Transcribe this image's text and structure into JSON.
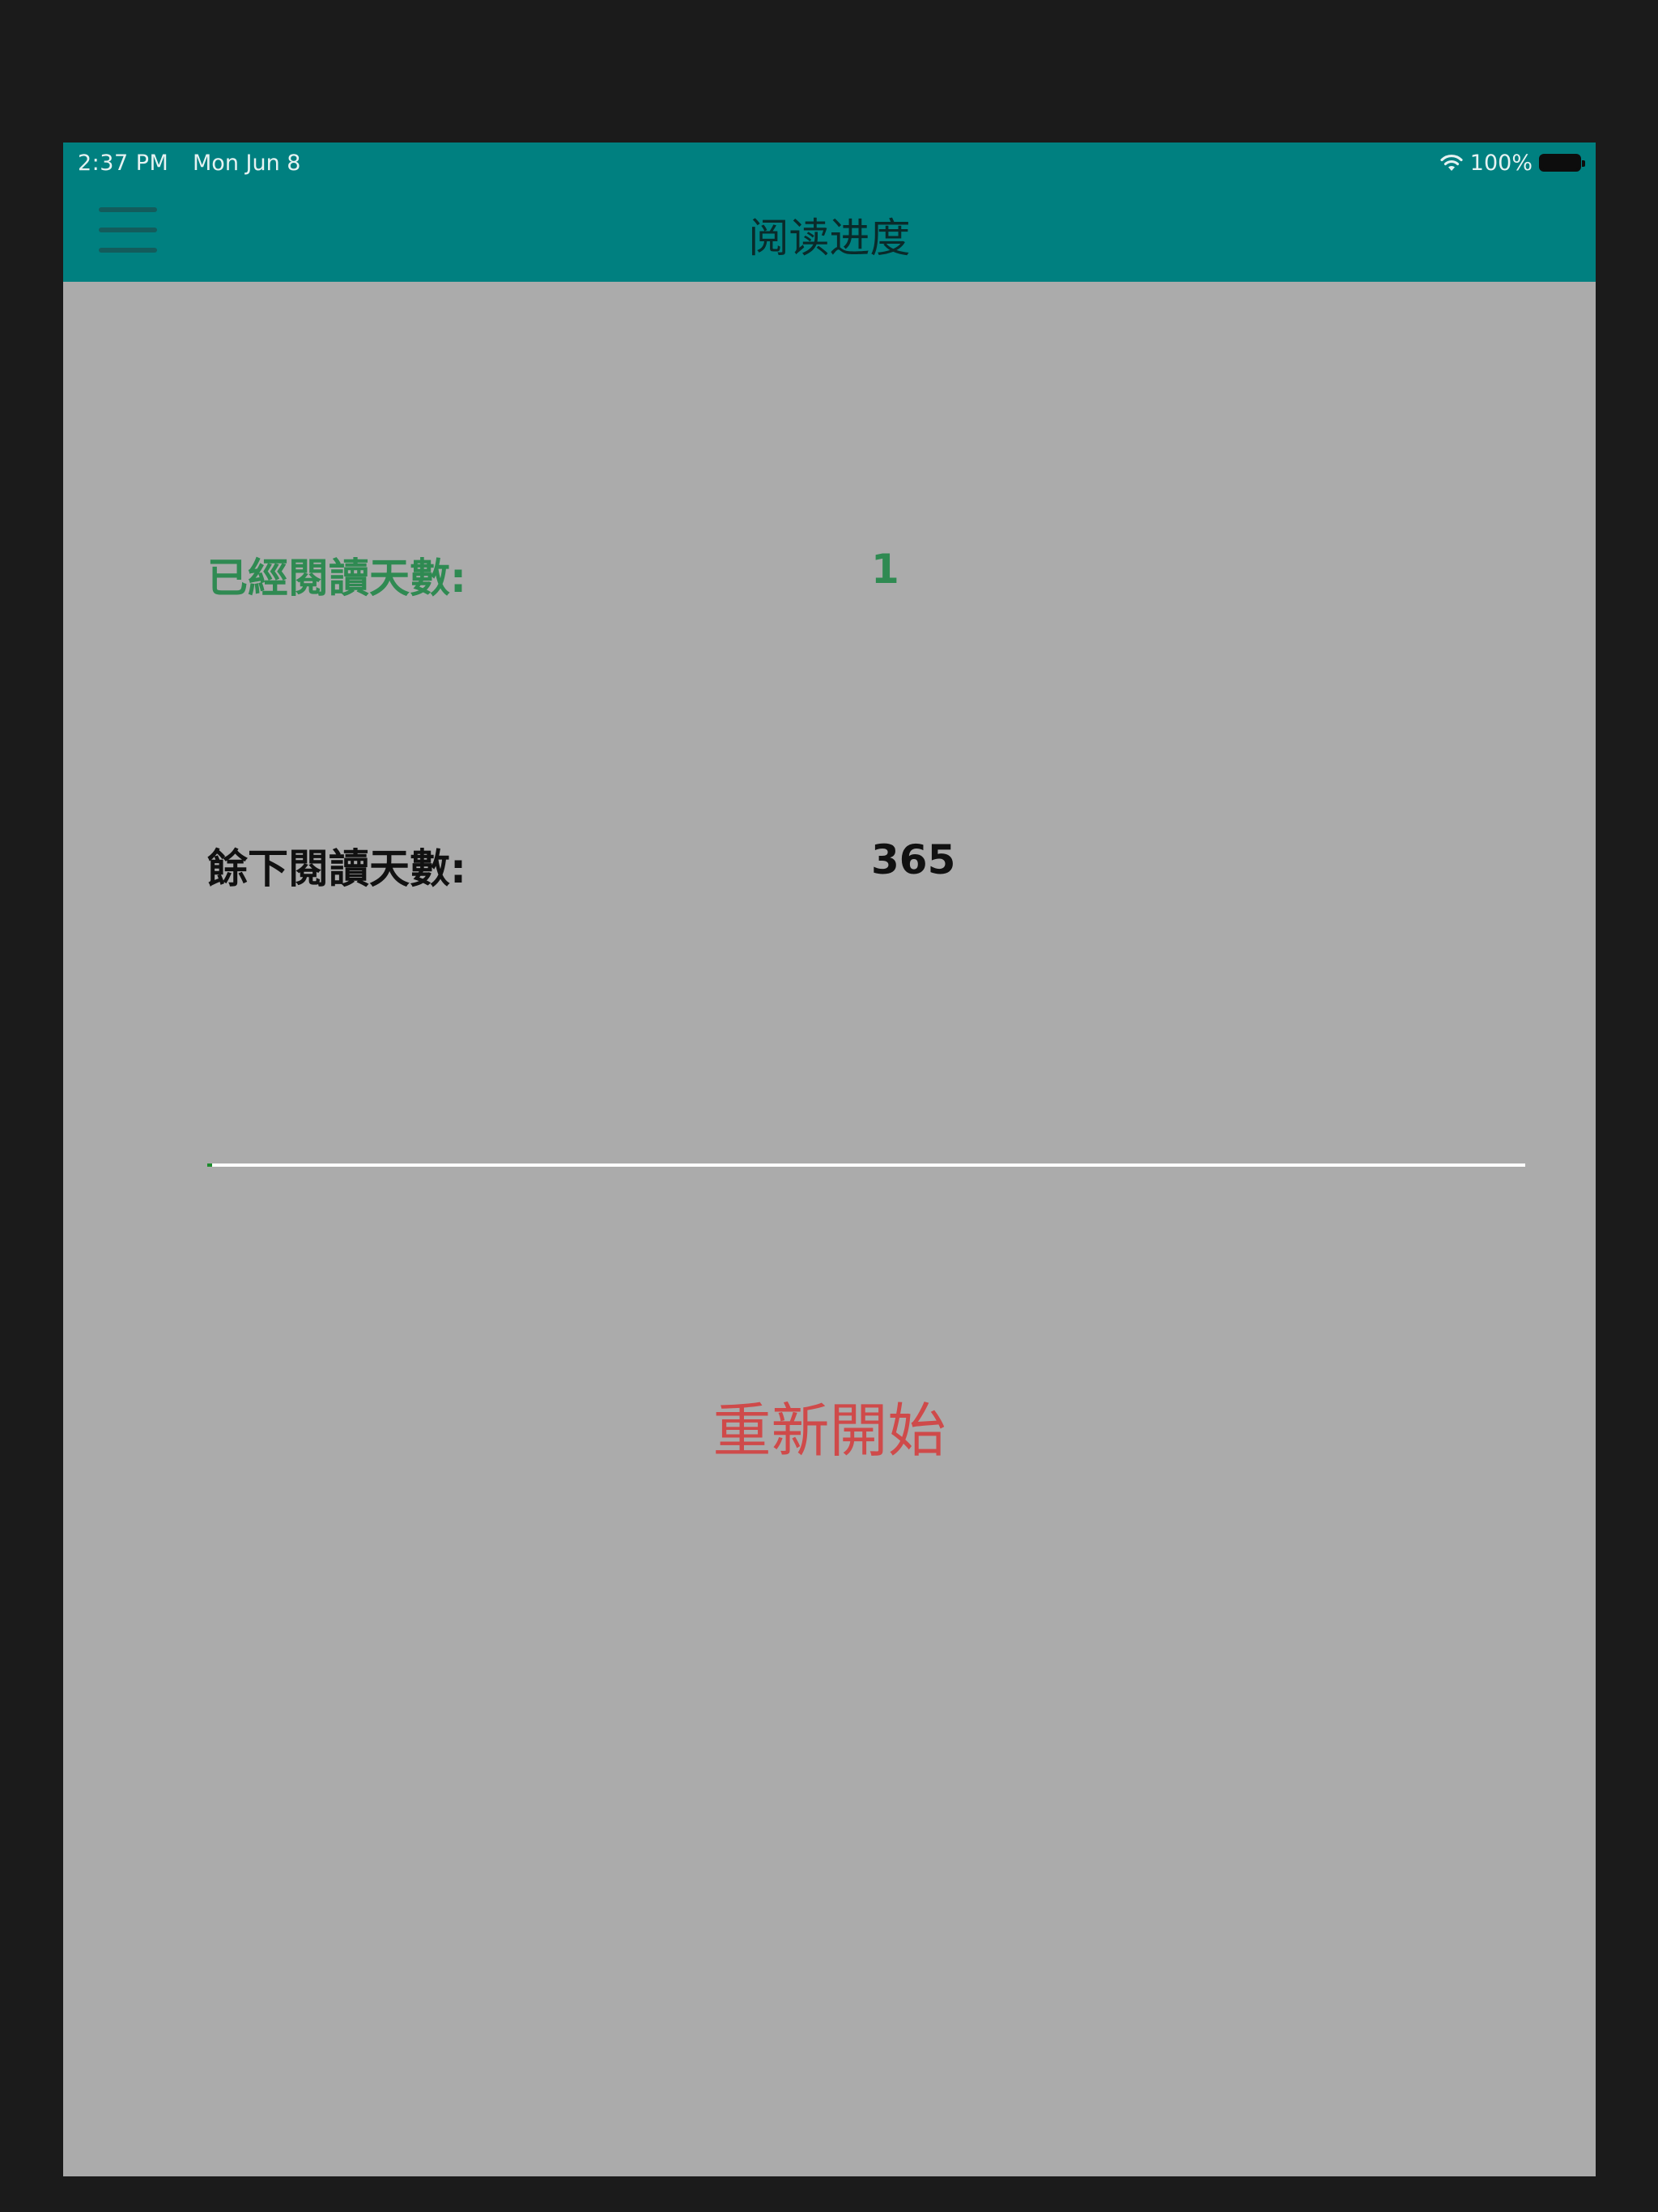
{
  "status_bar": {
    "time": "2:37 PM",
    "date": "Mon Jun 8",
    "wifi_icon": "wifi-icon",
    "battery_text": "100%",
    "battery_icon": "battery-icon"
  },
  "nav": {
    "title": "阅读进度",
    "menu_icon": "hamburger-menu-icon"
  },
  "stats": {
    "read_label": "已經閱讀天數:",
    "read_value": "1",
    "remaining_label": "餘下閱讀天數:",
    "remaining_value": "365"
  },
  "progress": {
    "value": 1,
    "max": 366,
    "fill_color": "#1c8c2c",
    "track_color": "#ffffff"
  },
  "actions": {
    "restart_label": "重新開始"
  },
  "colors": {
    "nav_bar": "#008080",
    "background": "#ababab",
    "read_text": "#2f8a52",
    "restart_text": "#cf4a4a"
  }
}
